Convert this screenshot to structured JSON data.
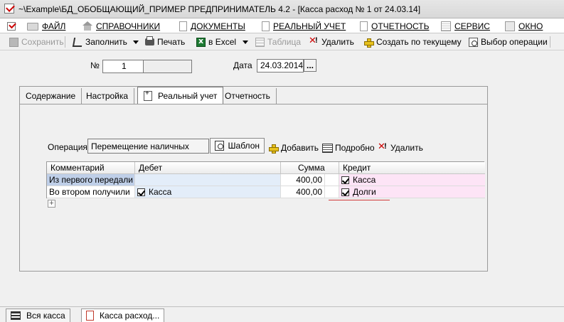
{
  "window": {
    "title": "~\\Example\\БД_ОБОБЩАЮЩИЙ_ПРИМЕР  ПРЕДПРИНИМАТЕЛЬ 4.2 - [Касса расход № 1 от 24.03.14]"
  },
  "menu": [
    {
      "label": "ФАЙЛ",
      "icon": "folder-icon"
    },
    {
      "label": "СПРАВОЧНИКИ",
      "icon": "home-icon"
    },
    {
      "label": "ДОКУМЕНТЫ",
      "icon": "document-icon"
    },
    {
      "label": "РЕАЛЬНЫЙ УЧЕТ",
      "icon": "document-icon"
    },
    {
      "label": "ОТЧЕТНОСТЬ",
      "icon": "document-icon"
    },
    {
      "label": "СЕРВИС",
      "icon": "grid-icon"
    },
    {
      "label": "ОКНО",
      "icon": "window-icon"
    }
  ],
  "toolbar": {
    "save": "Сохранить",
    "fill": "Заполнить",
    "print": "Печать",
    "excel": "в Excel",
    "table": "Таблица",
    "delete": "Удалить",
    "create_from_current": "Создать по текущему",
    "select_operation": "Выбор операции"
  },
  "header": {
    "number_label": "№",
    "number_value": "1",
    "date_label": "Дата",
    "date_value": "24.03.2014",
    "date_button": "..."
  },
  "tabs": [
    {
      "label": "Содержание",
      "active": false
    },
    {
      "label": "Настройка",
      "active": false
    },
    {
      "label": "Реальный учет",
      "active": true
    },
    {
      "label": "Отчетность",
      "active": false
    }
  ],
  "operation": {
    "label": "Операция",
    "value": "Перемещение наличных",
    "template_button": "Шаблон",
    "add_button": "Добавить",
    "details_button": "Подробно",
    "delete_button": "Удалить"
  },
  "grid": {
    "columns": [
      "Комментарий",
      "Дебет",
      "Сумма",
      "Кредит"
    ],
    "rows": [
      {
        "comment": "Из первого передали",
        "debit": "",
        "debit_checked": false,
        "sum": "400,00",
        "credit": "Касса",
        "credit_checked": true
      },
      {
        "comment": "Во втором получили",
        "debit": "Касса",
        "debit_checked": true,
        "sum": "400,00",
        "credit": "Долги",
        "credit_checked": true
      }
    ],
    "add_row": "+"
  },
  "bottom_tabs": [
    {
      "label": "Вся касса",
      "active": false
    },
    {
      "label": "Касса расход...",
      "active": true
    }
  ]
}
